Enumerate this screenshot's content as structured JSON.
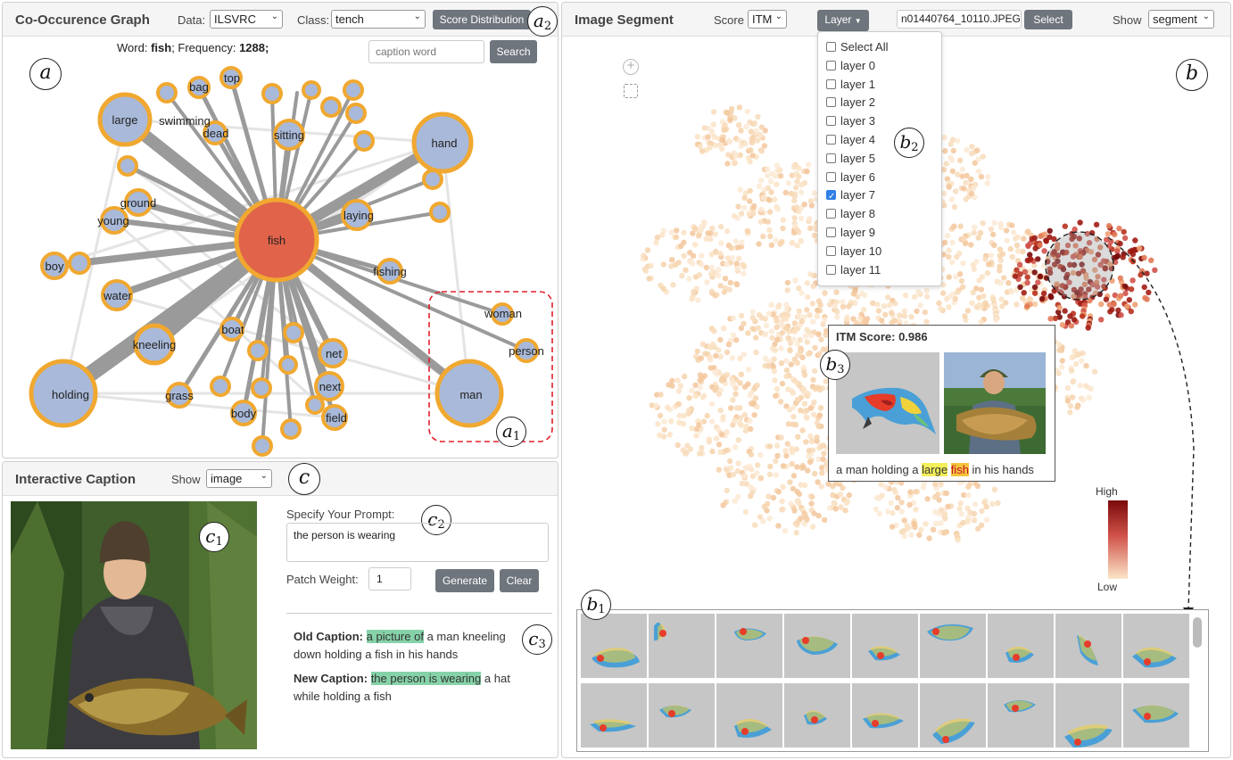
{
  "cooccurrence": {
    "title": "Co-Occurence Graph",
    "data_label": "Data:",
    "data_value": "ILSVRC",
    "class_label": "Class:",
    "class_value": "tench",
    "score_button": "Score Distribution",
    "word_label": "Word:",
    "word_value": "fish",
    "frequency_label": "; Frequency:",
    "frequency_value": "1288;",
    "search_placeholder": "caption word",
    "search_button": "Search",
    "node_labels": [
      "fish",
      "large",
      "hand",
      "holding",
      "man",
      "woman",
      "person",
      "bag",
      "top",
      "swimming",
      "dead",
      "sitting",
      "ground",
      "young",
      "laying",
      "fishing",
      "boy",
      "water",
      "kneeling",
      "boat",
      "net",
      "next",
      "field",
      "body",
      "grass"
    ],
    "center_color": "#e0634a",
    "node_color": "#a9b9d9",
    "node_stroke": "#f0a830"
  },
  "image_segment": {
    "title": "Image Segment",
    "score_label": "Score",
    "score_value": "ITM",
    "layer_button": "Layer",
    "file_value": "n01440764_10110.JPEG",
    "select_button": "Select",
    "show_label": "Show",
    "show_value": "segment",
    "layers": [
      {
        "label": "Select All",
        "checked": false
      },
      {
        "label": "layer 0",
        "checked": false
      },
      {
        "label": "layer 1",
        "checked": false
      },
      {
        "label": "layer 2",
        "checked": false
      },
      {
        "label": "layer 3",
        "checked": false
      },
      {
        "label": "layer 4",
        "checked": false
      },
      {
        "label": "layer 5",
        "checked": false
      },
      {
        "label": "layer 6",
        "checked": false
      },
      {
        "label": "layer 7",
        "checked": true
      },
      {
        "label": "layer 8",
        "checked": false
      },
      {
        "label": "layer 9",
        "checked": false
      },
      {
        "label": "layer 10",
        "checked": false
      },
      {
        "label": "layer 11",
        "checked": false
      }
    ],
    "tooltip_title": "ITM Score: 0.986",
    "tooltip_caption_pre": "a man holding a",
    "tooltip_caption_w1": "large",
    "tooltip_caption_w2": "fish",
    "tooltip_caption_post": "in his hands",
    "legend_high": "High",
    "legend_low": "Low",
    "colors": {
      "high": "#7a0a0a",
      "low": "#fbe6c8"
    }
  },
  "interactive_caption": {
    "title": "Interactive Caption",
    "show_label": "Show",
    "show_value": "image",
    "prompt_label": "Specify Your Prompt:",
    "prompt_value": "the person is wearing",
    "patch_label": "Patch Weight:",
    "patch_value": "1",
    "generate_button": "Generate",
    "clear_button": "Clear",
    "old_label": "Old Caption:",
    "old_highlight": "a picture of",
    "old_rest_1": "a man kneeling",
    "old_rest_2": "down holding a fish in his hands",
    "new_label": "New Caption:",
    "new_highlight": "the person is wearing",
    "new_rest_1": "a hat",
    "new_rest_2": "while holding a fish"
  },
  "markers": {
    "a": "a",
    "a1": "a",
    "a1_sub": "1",
    "a2": "a",
    "a2_sub": "2",
    "b": "b",
    "b1": "b",
    "b1_sub": "1",
    "b2": "b",
    "b2_sub": "2",
    "b3": "b",
    "b3_sub": "3",
    "c": "c",
    "c1": "c",
    "c1_sub": "1",
    "c2": "c",
    "c2_sub": "2",
    "c3": "c",
    "c3_sub": "3"
  }
}
